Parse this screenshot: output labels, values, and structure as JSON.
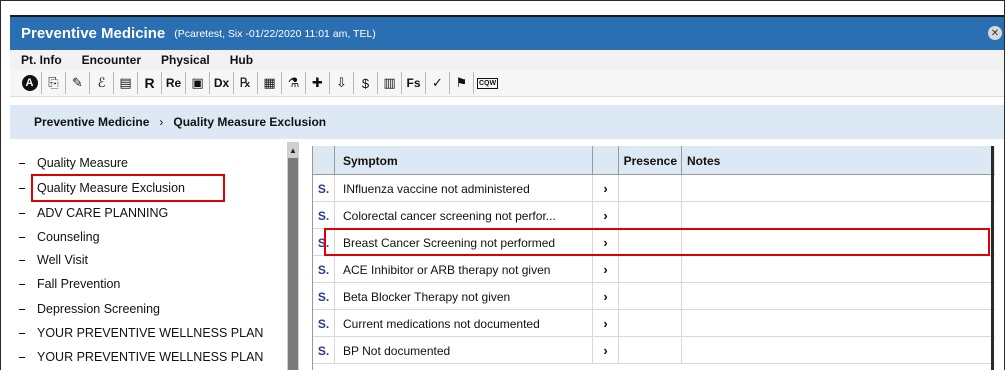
{
  "window": {
    "title": "Preventive Medicine",
    "subtitle": "(Pcaretest, Six -01/22/2020 11:01 am, TEL)",
    "close_glyph": "✕"
  },
  "menu": [
    "Pt. Info",
    "Encounter",
    "Physical",
    "Hub"
  ],
  "toolbar": [
    {
      "icon": "a-circle-icon",
      "text": "A"
    },
    {
      "icon": "copy-icon",
      "text": "⎘"
    },
    {
      "icon": "pencil-icon",
      "text": "✎"
    },
    {
      "icon": "hook-icon",
      "text": "ℰ"
    },
    {
      "icon": "note-icon",
      "text": "▤"
    },
    {
      "icon": "r-icon",
      "text": "R"
    },
    {
      "icon": "re-icon",
      "text": "Re"
    },
    {
      "icon": "clipboard-icon",
      "text": "▣"
    },
    {
      "icon": "dx-icon",
      "text": "Dx"
    },
    {
      "icon": "rx-icon",
      "text": "℞"
    },
    {
      "icon": "grid-icon",
      "text": "▦"
    },
    {
      "icon": "lab-icon",
      "text": "⚗"
    },
    {
      "icon": "medkit-icon",
      "text": "✚"
    },
    {
      "icon": "pin-icon",
      "text": "⇩"
    },
    {
      "icon": "billing-icon",
      "text": "$"
    },
    {
      "icon": "document-icon",
      "text": "▥"
    },
    {
      "icon": "flowsheet-icon",
      "text": "Fs"
    },
    {
      "icon": "check-icon",
      "text": "✓"
    },
    {
      "icon": "tag-icon",
      "text": "⚑"
    },
    {
      "icon": "cqw-icon",
      "text": "CQW"
    }
  ],
  "breadcrumb": {
    "parent": "Preventive Medicine",
    "separator": "›",
    "current": "Quality Measure Exclusion"
  },
  "sidebar": {
    "items": [
      {
        "label": "Quality Measure"
      },
      {
        "label": "Quality Measure Exclusion",
        "highlighted": true
      },
      {
        "label": "ADV CARE PLANNING"
      },
      {
        "label": "Counseling"
      },
      {
        "label": "Well Visit"
      },
      {
        "label": "Fall Prevention"
      },
      {
        "label": "Depression Screening"
      },
      {
        "label": "YOUR PREVENTIVE WELLNESS PLAN"
      },
      {
        "label": "YOUR PREVENTIVE WELLNESS PLAN"
      }
    ]
  },
  "table": {
    "columns": [
      "Symptom",
      "Presence",
      "Notes"
    ],
    "rows": [
      {
        "s": "S.",
        "symptom": "INfluenza vaccine not administered",
        "chevron": "›"
      },
      {
        "s": "S.",
        "symptom": "Colorectal cancer screening not perfor...",
        "chevron": "›"
      },
      {
        "s": "S.",
        "symptom": "Breast Cancer Screening not performed",
        "chevron": "›",
        "highlighted": true
      },
      {
        "s": "S.",
        "symptom": "ACE Inhibitor or ARB therapy not given",
        "chevron": "›"
      },
      {
        "s": "S.",
        "symptom": "Beta Blocker Therapy not given",
        "chevron": "›"
      },
      {
        "s": "S.",
        "symptom": "Current medications not documented",
        "chevron": "›"
      },
      {
        "s": "S.",
        "symptom": "BP Not documented",
        "chevron": "›"
      }
    ]
  },
  "colors": {
    "titlebar": "#2a6fb1",
    "header_bg": "#dce8f4",
    "highlight_border": "#e00000",
    "s_link": "#2a3a9a"
  }
}
